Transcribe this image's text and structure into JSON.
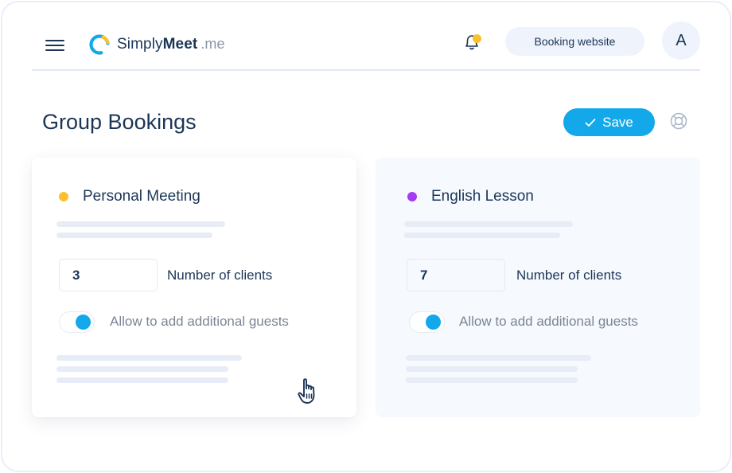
{
  "header": {
    "menu_icon": "hamburger-menu-icon",
    "logo": {
      "name_light": "Simply",
      "name_bold": "Meet",
      "tld": ".me",
      "icon": "logo-ring-icon",
      "colors": {
        "primary": "#12a8ea",
        "accent": "#fbc02d"
      }
    },
    "notification": {
      "icon": "bell-icon",
      "has_unread": true,
      "badge_color": "#fbc02d"
    },
    "booking_website_label": "Booking website",
    "avatar_initial": "A"
  },
  "page": {
    "title": "Group Bookings",
    "save_label": "Save",
    "save_icon": "check-icon",
    "help_icon": "lifebuoy-icon",
    "accent_color": "#12a8ea"
  },
  "cards": [
    {
      "title": "Personal Meeting",
      "dot_color": "#fbc02d",
      "clients_value": "3",
      "clients_label": "Number of clients",
      "allow_guests_label": "Allow to add additional guests",
      "allow_guests_enabled": true
    },
    {
      "title": "English Lesson",
      "dot_color": "#a53cf5",
      "clients_value": "7",
      "clients_label": "Number of clients",
      "allow_guests_label": "Allow to add additional guests",
      "allow_guests_enabled": true
    }
  ],
  "cursor": {
    "icon": "hand-pointer-icon"
  }
}
